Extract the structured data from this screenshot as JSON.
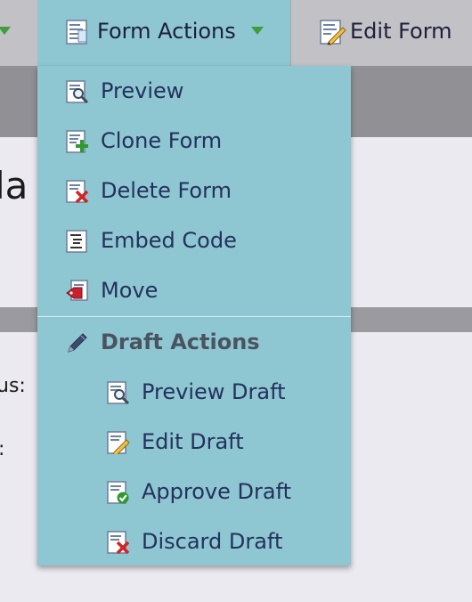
{
  "toolbar": {
    "form_actions_label": "Form Actions",
    "edit_form_label": "Edit Form"
  },
  "background": {
    "title_fragment": "la",
    "label1_fragment": "us:",
    "label2_fragment": ":"
  },
  "menu": {
    "items": [
      {
        "label": "Preview",
        "icon": "preview-icon"
      },
      {
        "label": "Clone Form",
        "icon": "clone-form-icon"
      },
      {
        "label": "Delete Form",
        "icon": "delete-form-icon"
      },
      {
        "label": "Embed Code",
        "icon": "embed-code-icon"
      },
      {
        "label": "Move",
        "icon": "move-icon"
      }
    ],
    "draft_section": {
      "label": "Draft Actions",
      "icon": "pencil-icon",
      "items": [
        {
          "label": "Preview Draft",
          "icon": "preview-draft-icon"
        },
        {
          "label": "Edit Draft",
          "icon": "edit-draft-icon"
        },
        {
          "label": "Approve Draft",
          "icon": "approve-draft-icon"
        },
        {
          "label": "Discard Draft",
          "icon": "discard-draft-icon"
        }
      ]
    }
  }
}
